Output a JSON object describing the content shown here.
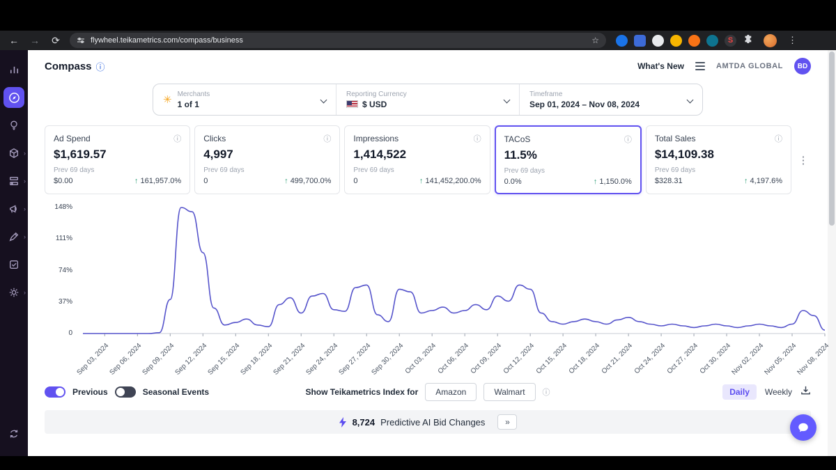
{
  "browser": {
    "url": "flywheel.teikametrics.com/compass/business"
  },
  "header": {
    "title": "Compass",
    "whats_new": "What's New",
    "account": "AMTDA GLOBAL",
    "avatar_initials": "BD"
  },
  "filters": {
    "merchants": {
      "label": "Merchants",
      "value": "1 of 1"
    },
    "currency": {
      "label": "Reporting Currency",
      "value": "$ USD"
    },
    "timeframe": {
      "label": "Timeframe",
      "value": "Sep 01, 2024 – Nov 08, 2024"
    }
  },
  "metrics": [
    {
      "label": "Ad Spend",
      "value": "$1,619.57",
      "prev_label": "Prev 69 days",
      "prev_value": "$0.00",
      "change": "161,957.0%",
      "selected": false
    },
    {
      "label": "Clicks",
      "value": "4,997",
      "prev_label": "Prev 69 days",
      "prev_value": "0",
      "change": "499,700.0%",
      "selected": false
    },
    {
      "label": "Impressions",
      "value": "1,414,522",
      "prev_label": "Prev 69 days",
      "prev_value": "0",
      "change": "141,452,200.0%",
      "selected": false
    },
    {
      "label": "TACoS",
      "value": "11.5%",
      "prev_label": "Prev 69 days",
      "prev_value": "0.0%",
      "change": "1,150.0%",
      "selected": true
    },
    {
      "label": "Total Sales",
      "value": "$14,109.38",
      "prev_label": "Prev 69 days",
      "prev_value": "$328.31",
      "change": "4,197.6%",
      "selected": false
    }
  ],
  "chart_data": {
    "type": "line",
    "series": [
      {
        "name": "TACoS",
        "values": [
          0,
          0,
          0,
          0,
          0,
          0,
          0,
          1,
          40,
          148,
          143,
          95,
          30,
          10,
          13,
          17,
          10,
          8,
          34,
          42,
          24,
          44,
          47,
          28,
          26,
          54,
          57,
          22,
          14,
          52,
          49,
          24,
          27,
          31,
          24,
          27,
          34,
          28,
          44,
          38,
          57,
          52,
          24,
          14,
          11,
          14,
          17,
          14,
          11,
          16,
          19,
          14,
          11,
          9,
          11,
          9,
          7,
          9,
          11,
          9,
          7,
          9,
          11,
          9,
          7,
          11,
          27,
          21,
          4
        ]
      }
    ],
    "x_range": [
      "Sep 01, 2024",
      "Nov 08, 2024"
    ],
    "tick_indices": [
      2,
      5,
      8,
      11,
      14,
      17,
      20,
      23,
      26,
      29,
      32,
      35,
      38,
      41,
      44,
      47,
      50,
      53,
      56,
      59,
      62,
      65,
      68
    ],
    "tick_labels": [
      "Sep 03, 2024",
      "Sep 06, 2024",
      "Sep 09, 2024",
      "Sep 12, 2024",
      "Sep 15, 2024",
      "Sep 18, 2024",
      "Sep 21, 2024",
      "Sep 24, 2024",
      "Sep 27, 2024",
      "Sep 30, 2024",
      "Oct 03, 2024",
      "Oct 06, 2024",
      "Oct 09, 2024",
      "Oct 12, 2024",
      "Oct 15, 2024",
      "Oct 18, 2024",
      "Oct 21, 2024",
      "Oct 24, 2024",
      "Oct 27, 2024",
      "Oct 30, 2024",
      "Nov 02, 2024",
      "Nov 05, 2024",
      "Nov 08, 2024"
    ],
    "y_ticks": [
      {
        "value": 0,
        "label": "0"
      },
      {
        "value": 37,
        "label": "37%"
      },
      {
        "value": 74,
        "label": "74%"
      },
      {
        "value": 111,
        "label": "111%"
      },
      {
        "value": 148,
        "label": "148%"
      }
    ],
    "ylim": [
      0,
      148
    ],
    "grid": false,
    "legend": "none",
    "line_color": "#5553cb"
  },
  "controls": {
    "previous_label": "Previous",
    "seasonal_label": "Seasonal Events",
    "index_label": "Show Teikametrics Index for",
    "amazon": "Amazon",
    "walmart": "Walmart",
    "daily": "Daily",
    "weekly": "Weekly"
  },
  "banner": {
    "count": "8,724",
    "label": "Predictive AI Bid Changes"
  },
  "colors": {
    "accent": "#6152f0",
    "line": "#5553cb",
    "positive": "#2f9e77",
    "sidebar_bg": "#16101f"
  }
}
